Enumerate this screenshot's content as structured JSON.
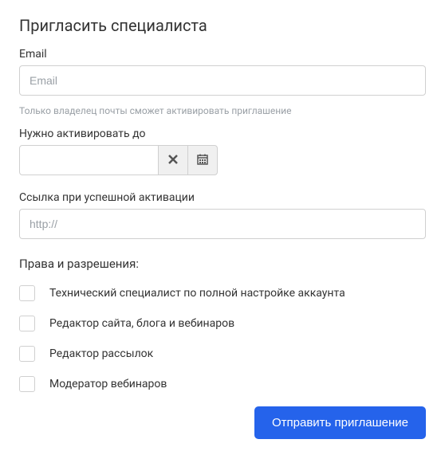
{
  "title": "Пригласить специалиста",
  "email": {
    "label": "Email",
    "placeholder": "Email",
    "hint": "Только владелец почты сможет активировать приглашение"
  },
  "activation_date": {
    "label": "Нужно активировать до",
    "value": ""
  },
  "success_link": {
    "label": "Ссылка при успешной активации",
    "placeholder": "http://"
  },
  "permissions": {
    "title": "Права и разрешения:",
    "items": [
      "Технический специалист по полной настройке аккаунта",
      "Редактор сайта, блога и вебинаров",
      "Редактор рассылок",
      "Модератор вебинаров"
    ]
  },
  "submit_label": "Отправить приглашение"
}
